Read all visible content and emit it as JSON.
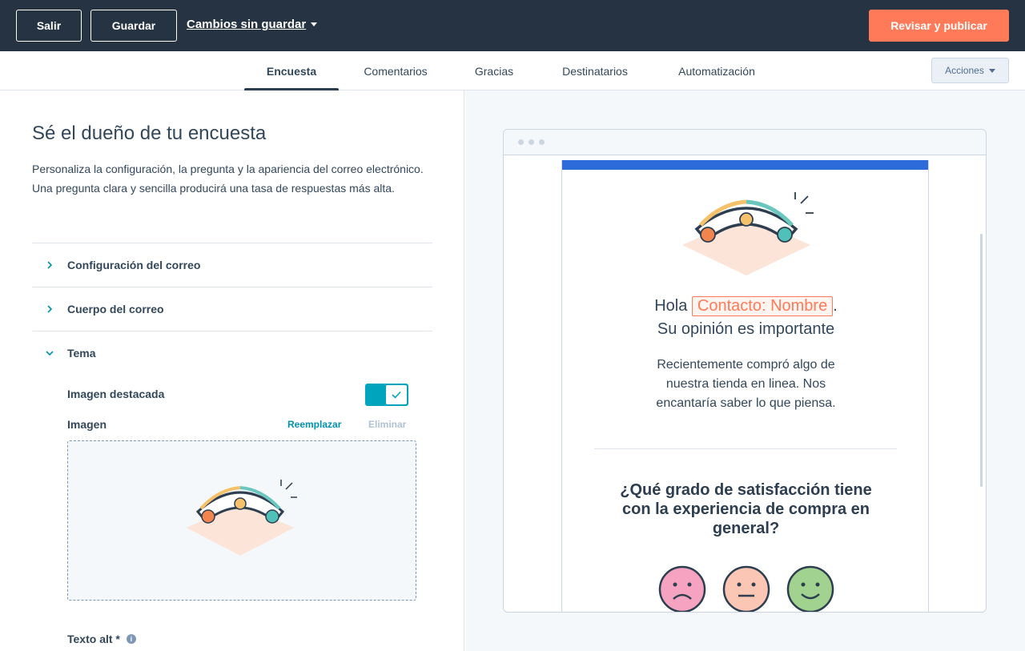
{
  "topbar": {
    "exit_label": "Salir",
    "save_label": "Guardar",
    "unsaved_label": "Cambios sin guardar",
    "publish_label": "Revisar y publicar"
  },
  "tabs": [
    {
      "label": "Encuesta",
      "active": true
    },
    {
      "label": "Comentarios",
      "active": false
    },
    {
      "label": "Gracias",
      "active": false
    },
    {
      "label": "Destinatarios",
      "active": false
    },
    {
      "label": "Automatización",
      "active": false
    }
  ],
  "actions_label": "Acciones",
  "left": {
    "title": "Sé el dueño de tu encuesta",
    "description": "Personaliza la configuración, la pregunta y la apariencia del correo electrónico. Una pregunta clara y sencilla producirá una tasa de respuestas más alta.",
    "sections": [
      {
        "label": "Configuración del correo",
        "expanded": false
      },
      {
        "label": "Cuerpo del correo",
        "expanded": false
      },
      {
        "label": "Tema",
        "expanded": true
      }
    ],
    "featured_image_label": "Imagen destacada",
    "featured_image_enabled": true,
    "image_label": "Imagen",
    "replace_label": "Reemplazar",
    "delete_label": "Eliminar",
    "alt_text_label": "Texto alt *"
  },
  "preview": {
    "greeting_prefix": "Hola",
    "contact_token": "Contacto: Nombre",
    "greeting_suffix": ".",
    "subline": "Su opinión es importante",
    "body": "Recientemente compró algo de nuestra tienda en linea. Nos encantaría saber lo que piensa.",
    "question": "¿Qué grado de satisfacción tiene con la experiencia de compra en general?"
  },
  "colors": {
    "topbar": "#253342",
    "accent": "#ff7a59",
    "teal": "#00a4bd",
    "email_header": "#2d6bdb",
    "face_sad": "#f5a3c0",
    "face_neutral": "#fcc6b4",
    "face_happy": "#a2d28f"
  }
}
